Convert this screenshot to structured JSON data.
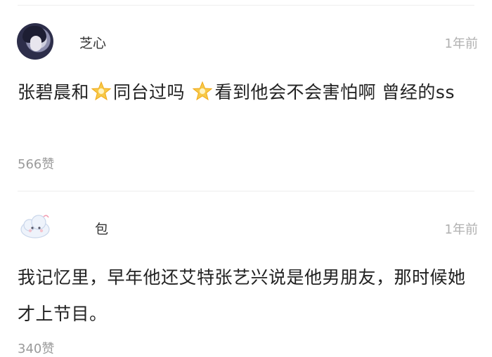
{
  "comments": [
    {
      "username": "芝心",
      "time": "1年前",
      "text_part1": "张碧晨和",
      "text_part2": "同台过吗",
      "text_part3": "看到他会不会害怕啊 曾经的ss",
      "star_icon": "star-emoji-icon",
      "likes": "566赞"
    },
    {
      "username": "包",
      "time": "1年前",
      "text": "我记忆里，早年他还艾特张艺兴说是他男朋友，那时候她才上节目。",
      "likes": "340赞"
    }
  ],
  "colors": {
    "time_gray": "#b0b0b0",
    "likes_gray": "#9a9a9a",
    "text": "#222222",
    "star": "#f7c948"
  }
}
